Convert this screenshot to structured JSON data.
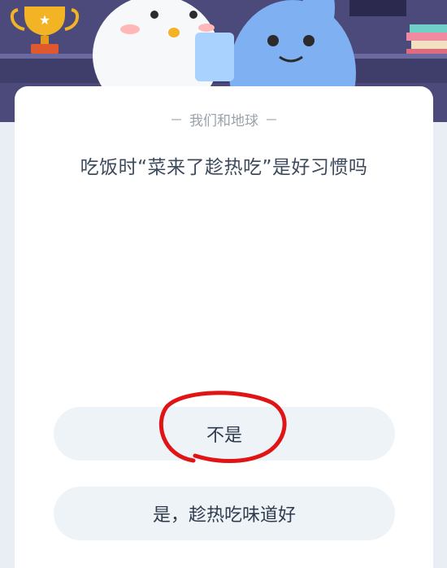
{
  "quiz": {
    "category": "我们和地球",
    "question": "吃饭时“菜来了趁热吃”是好习惯吗",
    "options": [
      {
        "label": "不是"
      },
      {
        "label": "是，趁热吃味道好"
      }
    ]
  },
  "annotation": {
    "type": "hand-drawn circle",
    "target": "option-0",
    "color": "#e01414"
  },
  "banner": {
    "icons": [
      "trophy-icon",
      "penguin-mascot",
      "blue-rabbit-mascot",
      "books-icon"
    ]
  }
}
